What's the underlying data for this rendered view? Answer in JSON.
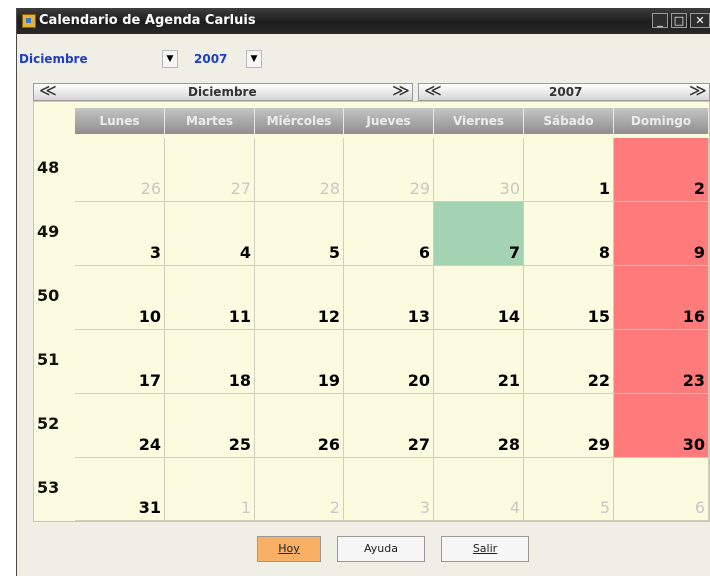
{
  "window": {
    "title": "Calendario de Agenda Carluis",
    "minimize_label": "_",
    "maximize_label": "□",
    "close_label": "✕"
  },
  "selectors": {
    "month": {
      "value": "Diciembre",
      "arrow": "▼"
    },
    "year": {
      "value": "2007",
      "arrow": "▼"
    }
  },
  "nav": {
    "month_label": "Diciembre",
    "year_label": "2007",
    "prev_glyph": "≪",
    "next_glyph": "≫"
  },
  "weekdays": [
    "Lunes",
    "Martes",
    "Miércoles",
    "Jueves",
    "Viernes",
    "Sábado",
    "Domingo"
  ],
  "weeks": [
    {
      "number": "48",
      "days": [
        {
          "n": "26",
          "other": true
        },
        {
          "n": "27",
          "other": true
        },
        {
          "n": "28",
          "other": true
        },
        {
          "n": "29",
          "other": true
        },
        {
          "n": "30",
          "other": true
        },
        {
          "n": "1"
        },
        {
          "n": "2",
          "holiday": true
        }
      ]
    },
    {
      "number": "49",
      "days": [
        {
          "n": "3"
        },
        {
          "n": "4"
        },
        {
          "n": "5"
        },
        {
          "n": "6"
        },
        {
          "n": "7",
          "today": true
        },
        {
          "n": "8"
        },
        {
          "n": "9",
          "holiday": true
        }
      ]
    },
    {
      "number": "50",
      "days": [
        {
          "n": "10"
        },
        {
          "n": "11"
        },
        {
          "n": "12"
        },
        {
          "n": "13"
        },
        {
          "n": "14"
        },
        {
          "n": "15"
        },
        {
          "n": "16",
          "holiday": true
        }
      ]
    },
    {
      "number": "51",
      "days": [
        {
          "n": "17"
        },
        {
          "n": "18"
        },
        {
          "n": "19"
        },
        {
          "n": "20"
        },
        {
          "n": "21"
        },
        {
          "n": "22"
        },
        {
          "n": "23",
          "holiday": true
        }
      ]
    },
    {
      "number": "52",
      "days": [
        {
          "n": "24"
        },
        {
          "n": "25"
        },
        {
          "n": "26"
        },
        {
          "n": "27"
        },
        {
          "n": "28"
        },
        {
          "n": "29"
        },
        {
          "n": "30",
          "holiday": true
        }
      ]
    },
    {
      "number": "53",
      "days": [
        {
          "n": "31"
        },
        {
          "n": "1",
          "other": true
        },
        {
          "n": "2",
          "other": true
        },
        {
          "n": "3",
          "other": true
        },
        {
          "n": "4",
          "other": true
        },
        {
          "n": "5",
          "other": true
        },
        {
          "n": "6",
          "other": true
        }
      ]
    }
  ],
  "buttons": {
    "today": "Hoy",
    "help": "Ayuda",
    "exit": "Salir"
  },
  "colors": {
    "holiday": "#ff7b7b",
    "today": "#a3d3b3",
    "cell": "#fbfbe0",
    "other_month_text": "#c8c8c8",
    "today_button": "#f7b064",
    "selector_text": "#1f3dc4"
  }
}
